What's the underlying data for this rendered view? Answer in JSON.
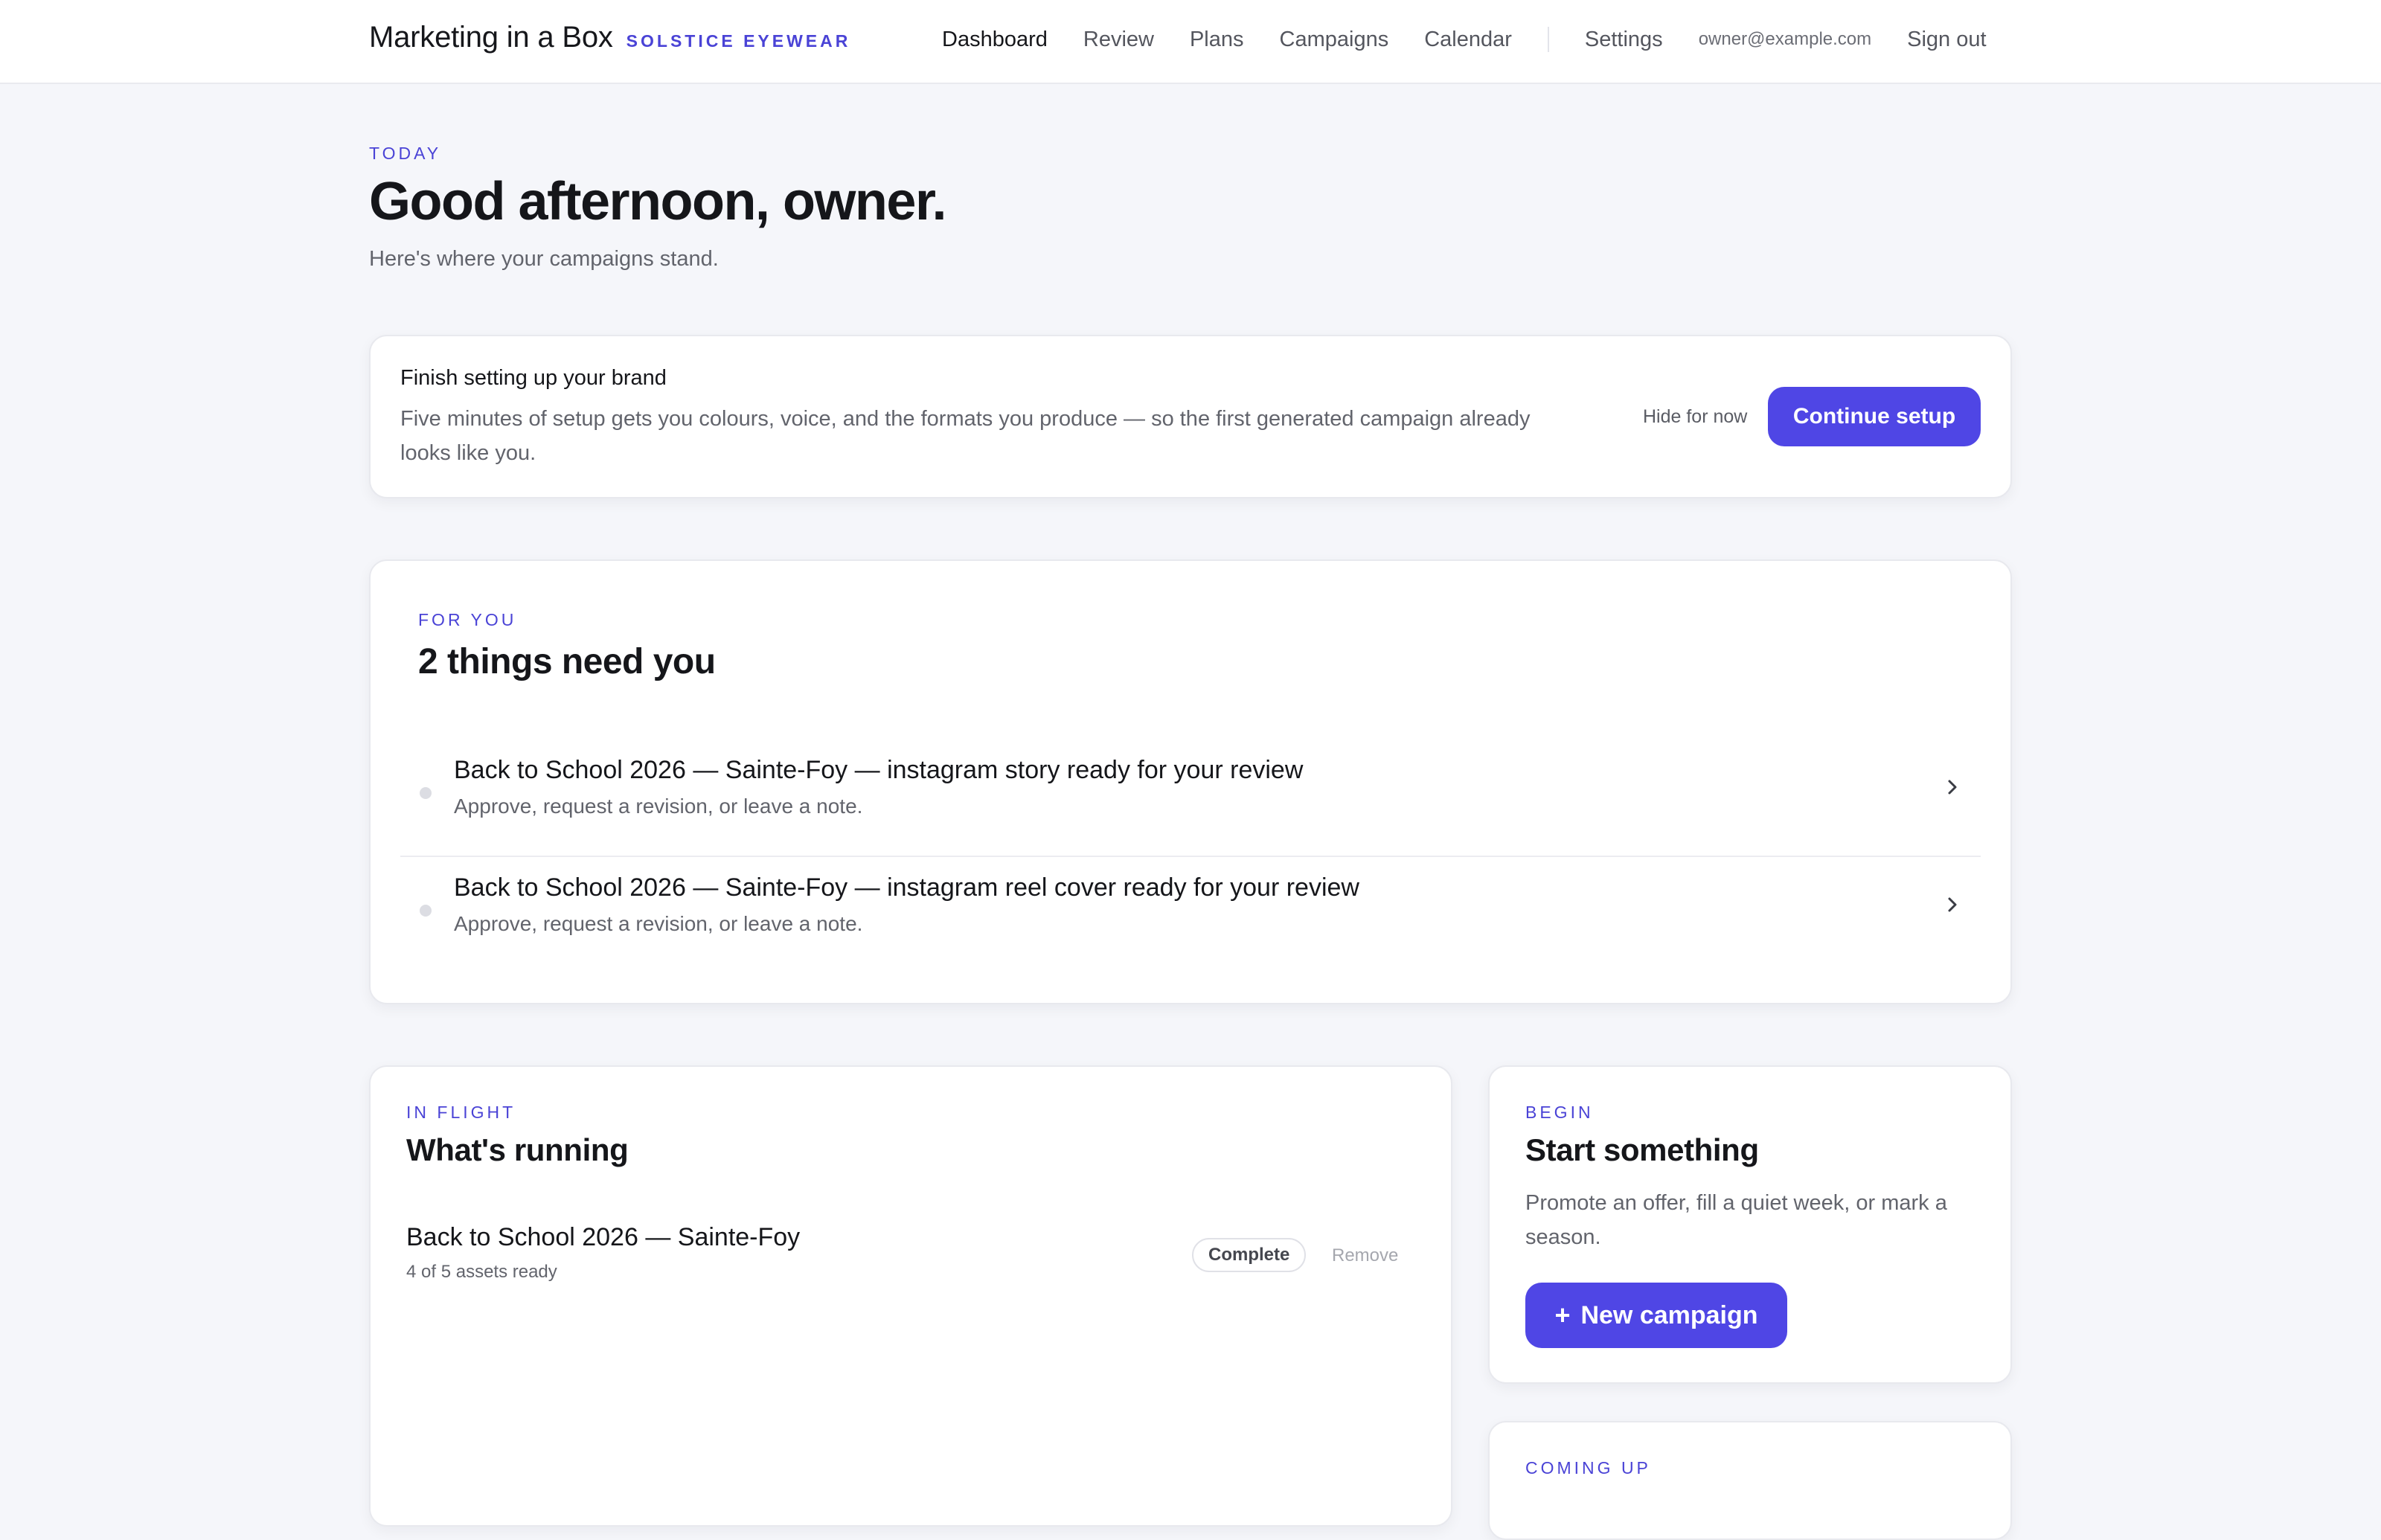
{
  "brand": {
    "name": "Marketing in a Box",
    "client": "SOLSTICE EYEWEAR"
  },
  "nav": {
    "items": [
      "Dashboard",
      "Review",
      "Plans",
      "Campaigns",
      "Calendar"
    ],
    "active": "Dashboard",
    "settings": "Settings",
    "email": "owner@example.com",
    "sign_out": "Sign out"
  },
  "hero": {
    "eyebrow": "TODAY",
    "title": "Good afternoon, owner.",
    "subtitle": "Here's where your campaigns stand."
  },
  "setup": {
    "title": "Finish setting up your brand",
    "description": "Five minutes of setup gets you colours, voice, and the formats you produce — so the first generated campaign already looks like you.",
    "hide_label": "Hide for now",
    "continue_label": "Continue setup"
  },
  "for_you": {
    "eyebrow": "FOR YOU",
    "title": "2 things need you",
    "items": [
      {
        "title": "Back to School 2026 — Sainte-Foy — instagram story ready for your review",
        "subtitle": "Approve, request a revision, or leave a note."
      },
      {
        "title": "Back to School 2026 — Sainte-Foy — instagram reel cover ready for your review",
        "subtitle": "Approve, request a revision, or leave a note."
      }
    ]
  },
  "in_flight": {
    "eyebrow": "IN FLIGHT",
    "title": "What's running",
    "campaigns": [
      {
        "name": "Back to School 2026 — Sainte-Foy",
        "progress": "4 of 5 assets ready",
        "status": "Complete",
        "remove_label": "Remove"
      }
    ]
  },
  "begin": {
    "eyebrow": "BEGIN",
    "title": "Start something",
    "description": "Promote an offer, fill a quiet week, or mark a season.",
    "button_icon": "+",
    "button_label": "New campaign"
  },
  "coming_up": {
    "eyebrow": "COMING UP"
  },
  "colors": {
    "accent": "#4f46e5",
    "eyebrow": "#4a43d6",
    "background": "#f5f6fa"
  }
}
